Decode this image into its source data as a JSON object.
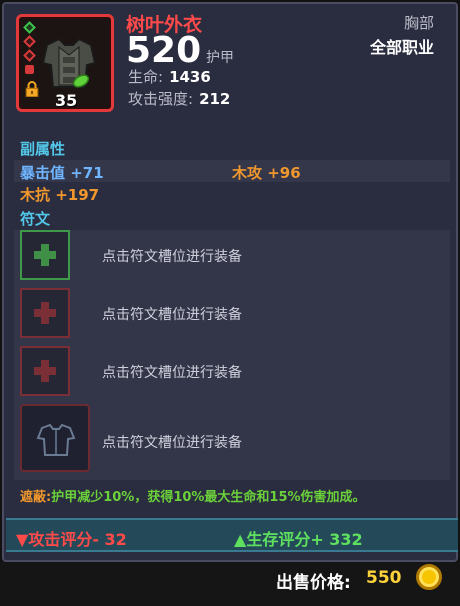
{
  "item": {
    "name": "树叶外衣",
    "armor_value": "520",
    "armor_label": "护甲",
    "slot": "胸部",
    "class": "全部职业",
    "level": "35",
    "stats": [
      {
        "label": "生命:",
        "value": "1436"
      },
      {
        "label": "攻击强度:",
        "value": "212"
      }
    ]
  },
  "sub_attributes": {
    "title": "副属性",
    "items": [
      {
        "text": "暴击值 +71",
        "color": "#6fb5ff"
      },
      {
        "text": "木攻 +96",
        "color": "#f0972e"
      },
      {
        "text": "木抗 +197",
        "color": "#f0972e"
      }
    ]
  },
  "runes": {
    "title": "符文",
    "slots": [
      {
        "hint": "点击符文槽位进行装备",
        "state": "available"
      },
      {
        "hint": "点击符文槽位进行装备",
        "state": "locked"
      },
      {
        "hint": "点击符文槽位进行装备",
        "state": "locked"
      },
      {
        "hint": "点击符文槽位进行装备",
        "state": "armor"
      }
    ]
  },
  "effect": {
    "label": "遮蔽:",
    "text": "护甲减少10%，获得10%最大生命和15%伤害加成。"
  },
  "scores": {
    "attack": "攻击评分- 32",
    "survival": "生存评分+ 332"
  },
  "footer": {
    "price_label": "出售价格:",
    "price_value": "550"
  },
  "colors": {
    "accent_red": "#ff4a4a",
    "accent_green": "#5ee05e",
    "accent_blue": "#52c7e8",
    "gold": "#ffd23a"
  }
}
